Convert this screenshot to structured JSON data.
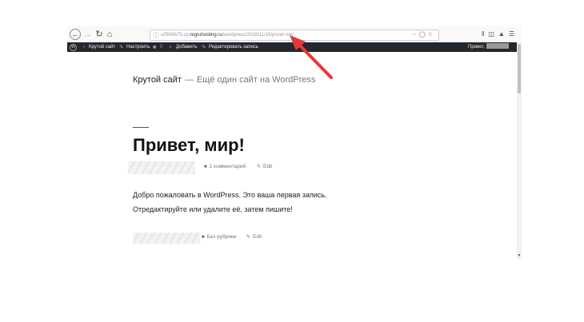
{
  "browser": {
    "url_prefix": "u0596675.cp.",
    "url_host": "regruhosting.ru",
    "url_path": "/wordpress/2018/11/15/privet-mir/"
  },
  "adminbar": {
    "site_name": "Крутой сайт",
    "customize": "Настроить",
    "comments_count": "0",
    "new": "Добавить",
    "edit_post": "Редактировать запись",
    "greeting": "Привет,"
  },
  "site": {
    "title": "Крутой сайт",
    "dash": "—",
    "description": "Ещё один сайт на WordPress"
  },
  "post": {
    "title": "Привет, мир!",
    "comments": "1 комментарий",
    "edit": "Edit",
    "paragraph1": "Добро пожаловать в WordPress. Это ваша первая запись.",
    "paragraph2": "Отредактируйте или удалите её, затем пишите!",
    "category": "Без рубрики",
    "edit2": "Edit"
  },
  "colors": {
    "adminbar_bg": "#23282d",
    "arrow": "#e53935"
  },
  "icons": [
    "back-arrow-icon",
    "forward-arrow-icon",
    "reload-icon",
    "home-icon",
    "info-icon",
    "more-icon",
    "pocket-icon",
    "bookmark-star-icon",
    "library-icon",
    "sidebar-icon",
    "sync-icon",
    "menu-icon",
    "wordpress-logo-icon",
    "dashboard-icon",
    "brush-icon",
    "comment-icon",
    "plus-icon",
    "pencil-icon",
    "folder-icon"
  ]
}
